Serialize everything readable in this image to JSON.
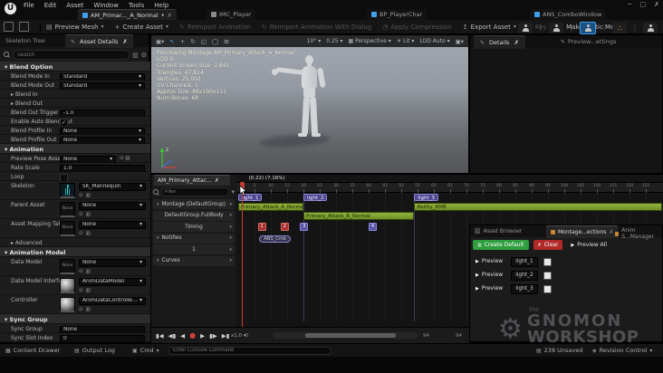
{
  "colors": {
    "accent_blue": "#3f9fe8",
    "segment_green": "#87a93d",
    "section_purple": "#4e4991",
    "notify_red": "#a83230",
    "branch_purple": "#5a54a8",
    "create_green": "#2f9e3f",
    "clear_red": "#b02a2a",
    "playhead_red": "#d23c34",
    "skeleton_teal": "#3fd2d2"
  },
  "titlebar": {
    "logo": "U",
    "menus": [
      "File",
      "Edit",
      "Asset",
      "Window",
      "Tools",
      "Help"
    ],
    "window_buttons": [
      {
        "name": "minimize",
        "glyph": "─"
      },
      {
        "name": "maximize",
        "glyph": "□"
      },
      {
        "name": "close",
        "glyph": "✗"
      }
    ]
  },
  "asset_tabs": [
    {
      "label": "AM_Primar..._A_Normal",
      "modified": true,
      "active": true,
      "icon_color": "#3f9fe8"
    },
    {
      "label": "IMC_Player",
      "icon_color": "#8a8a8a"
    },
    {
      "label": "BP_PlayerChar",
      "icon_color": "#3f9fe8"
    },
    {
      "label": "ANS_ComboWindow",
      "icon_color": "#3f9fe8"
    }
  ],
  "toolbar": {
    "buttons": [
      {
        "label": "Preview Mesh",
        "dropdown": true,
        "icon": "preview-mesh"
      },
      {
        "label": "Create Asset",
        "dropdown": true,
        "icon": "create-asset"
      },
      {
        "label": "Reimport Animation",
        "disabled": true,
        "icon": "reimport"
      },
      {
        "label": "Reimport Animation With Dialog",
        "disabled": true,
        "icon": "reimport-dialog"
      },
      {
        "label": "Apply Compression",
        "disabled": true,
        "icon": "compression"
      },
      {
        "label": "Export Asset",
        "dropdown": true,
        "icon": "export"
      },
      {
        "label": "Key",
        "disabled": true,
        "icon": "plus"
      },
      {
        "label": "Make Static Mesh",
        "icon": "static-mesh"
      }
    ]
  },
  "left_panel": {
    "tabs": [
      {
        "label": "Skeleton Tree"
      },
      {
        "label": "Asset Details",
        "active": true
      }
    ],
    "search_placeholder": "Search",
    "rows": [
      {
        "type": "section",
        "label": "Blend Option"
      },
      {
        "type": "dropdown",
        "label": "Blend Mode In",
        "value": "Standard"
      },
      {
        "type": "dropdown",
        "label": "Blend Mode Out",
        "value": "Standard"
      },
      {
        "type": "expander",
        "label": "Blend In"
      },
      {
        "type": "expander",
        "label": "Blend Out"
      },
      {
        "type": "input",
        "label": "Blend Out Trigger Time",
        "value": "-1.0"
      },
      {
        "type": "checkbox",
        "label": "Enable Auto Blend Out",
        "checked": true
      },
      {
        "type": "dropdown",
        "label": "Blend Profile In",
        "value": "None"
      },
      {
        "type": "dropdown",
        "label": "Blend Profile Out",
        "value": "None"
      },
      {
        "type": "section",
        "label": "Animation"
      },
      {
        "type": "asset-dd",
        "label": "Preview Pose Asset",
        "value": "None"
      },
      {
        "type": "input",
        "label": "Rate Scale",
        "value": "1.0"
      },
      {
        "type": "checkbox",
        "label": "Loop",
        "checked": false
      },
      {
        "type": "asset",
        "label": "Skeleton",
        "value": "SK_Mannequin",
        "thumb": "skeleton"
      },
      {
        "type": "asset",
        "label": "Parent Asset",
        "value": "None",
        "thumb": "none"
      },
      {
        "type": "asset",
        "label": "Asset Mapping Table",
        "value": "None",
        "thumb": "none"
      },
      {
        "type": "expander",
        "label": "Advanced"
      },
      {
        "type": "section",
        "label": "Animation Model"
      },
      {
        "type": "asset",
        "label": "Data Model",
        "value": "None",
        "thumb": "none"
      },
      {
        "type": "asset",
        "label": "Data Model Interface",
        "value": "AnimDataModel",
        "thumb": "sphere"
      },
      {
        "type": "asset",
        "label": "Controller",
        "value": "AnimDataControlle...",
        "thumb": "sphere"
      },
      {
        "type": "section",
        "label": "Sync Group"
      },
      {
        "type": "input",
        "label": "Sync Group",
        "value": "None"
      },
      {
        "type": "input",
        "label": "Sync Slot Index",
        "value": "0"
      }
    ]
  },
  "viewport": {
    "overlay": [
      "Previewing Montage AM_Primary_Attack_A_Normal",
      "LOD 0",
      "Current Screen Size: 1.841",
      "Triangles: 47,824",
      "Vertices: 25,002",
      "UV Channels: 1",
      "Approx Size: 88x190x111",
      "Num Bones: 68"
    ],
    "toolbar": {
      "snap_angle": "10°",
      "snap_scale": "0.25",
      "perspective": "Perspective",
      "lit": "Lit",
      "lod": "LOD Auto"
    }
  },
  "details_panel": {
    "tabs": [
      {
        "label": "Details",
        "active": true
      },
      {
        "label": "Preview...ettings"
      }
    ]
  },
  "montage": {
    "tab_label": "AM_Primary_Attac...",
    "filter_placeholder": "Filter",
    "tree": [
      {
        "label": "Montage (DefaultGroup)",
        "chevron_left": true
      },
      {
        "label": "DefaultGroup.FullBody",
        "center": true
      },
      {
        "label": "Timing",
        "center": true
      },
      {
        "label": "Notifies",
        "chevron_left": true
      },
      {
        "label": "1",
        "center": true
      },
      {
        "label": "Curves",
        "chevron_left": true
      }
    ],
    "playhead": {
      "label": "(0.22) (7.16%)",
      "frame": 1
    },
    "ruler": {
      "start": 0,
      "end": 129,
      "step": 5
    },
    "sections": [
      {
        "name": "light_1",
        "frame": 0
      },
      {
        "name": "light_2",
        "frame": 20
      },
      {
        "name": "light_3",
        "frame": 54
      }
    ],
    "segments": [
      {
        "name": "Primary_Attack_A_Normal",
        "from": 0,
        "to": 20,
        "row": 0
      },
      {
        "name": "Primary_Attack_B_Normal",
        "from": 20,
        "to": 54,
        "row": 1
      },
      {
        "name": "Ability_RMB",
        "from": 54,
        "to": 131,
        "row": 0
      }
    ],
    "markers": [
      {
        "label": "1",
        "frame": 6,
        "kind": "notify"
      },
      {
        "label": "2",
        "frame": 13,
        "kind": "notify"
      },
      {
        "label": "3",
        "frame": 19,
        "kind": "branch"
      },
      {
        "label": "4",
        "frame": 40,
        "kind": "branch"
      }
    ],
    "notify_state": {
      "label": "ANS_Cmb",
      "from": 6.5,
      "to": 16
    },
    "transport": {
      "buttons": [
        {
          "name": "to-front",
          "glyph": "▮◀"
        },
        {
          "name": "step-back",
          "glyph": "◀▮"
        },
        {
          "name": "play-reverse",
          "glyph": "◀"
        },
        {
          "name": "record",
          "glyph": "●"
        },
        {
          "name": "play",
          "glyph": "▶"
        },
        {
          "name": "step-forward",
          "glyph": "▮▶"
        },
        {
          "name": "to-end",
          "glyph": "▶▮"
        }
      ],
      "speed": "x1.0",
      "range_start": "0",
      "range_end": "94",
      "total": "94"
    }
  },
  "asset_browser": {
    "tabs": [
      {
        "label": "Asset Browser"
      },
      {
        "label": "Montage...ections",
        "active": true
      },
      {
        "label": "Anim S...Manager"
      }
    ],
    "create_button": "Create Default",
    "clear_button": "Clear",
    "preview_all_button": "Preview All",
    "rows": [
      {
        "action": "Preview",
        "section": "light_1"
      },
      {
        "action": "Preview",
        "section": "light_2"
      },
      {
        "action": "Preview",
        "section": "light_3"
      }
    ]
  },
  "status_bar": {
    "content_drawer": "Content Drawer",
    "output_log": "Output Log",
    "cmd": "Cmd",
    "console_placeholder": "Enter Console Command",
    "unsaved": "238 Unsaved",
    "revision": "Revision Control"
  },
  "watermark": {
    "prefix": "the",
    "line1": "GNOMON",
    "line2": "WORKSHOP"
  }
}
